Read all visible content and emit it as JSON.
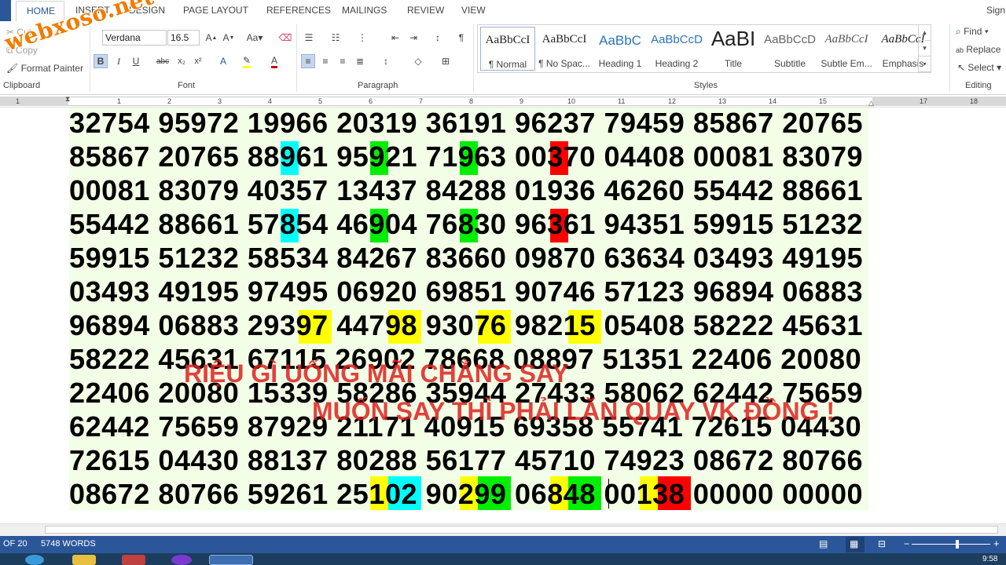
{
  "tabs": {
    "home": "HOME",
    "items": [
      "INSERT",
      "DESIGN",
      "PAGE LAYOUT",
      "REFERENCES",
      "MAILINGS",
      "REVIEW",
      "VIEW"
    ],
    "sign_in": "Sign"
  },
  "clipboard": {
    "cut": "Cut",
    "copy": "Copy",
    "format_painter": "Format Painter",
    "label": "Clipboard"
  },
  "font": {
    "name": "Verdana",
    "size": "16.5",
    "label": "Font"
  },
  "paragraph": {
    "label": "Paragraph"
  },
  "styles": {
    "label": "Styles",
    "items": [
      {
        "preview": "AaBbCcI",
        "name": "¶ Normal"
      },
      {
        "preview": "AaBbCcI",
        "name": "¶ No Spac..."
      },
      {
        "preview": "AaBbC",
        "name": "Heading 1"
      },
      {
        "preview": "AaBbCcD",
        "name": "Heading 2"
      },
      {
        "preview": "AaBI",
        "name": "Title"
      },
      {
        "preview": "AaBbCcD",
        "name": "Subtitle"
      },
      {
        "preview": "AaBbCcI",
        "name": "Subtle Em..."
      },
      {
        "preview": "AaBbCcI",
        "name": "Emphasis"
      }
    ]
  },
  "editing": {
    "find": "Find",
    "replace": "Replace",
    "select": "Select",
    "label": "Editing"
  },
  "ruler_numbers": [
    "1",
    "1",
    "2",
    "3",
    "4",
    "5",
    "6",
    "7",
    "8",
    "9",
    "10",
    "11",
    "12",
    "13",
    "14",
    "15",
    "17",
    "18"
  ],
  "document": {
    "rows": [
      "32754 95972 19966 20319 36191 96237 79459 85867 20765",
      "85867 20765 88961 95921 71963 00370 04408 00081 83079",
      "00081 83079 40357 13437 84288 01936 46260 55442 88661",
      "55442 88661 57854 46904 76830 96361 94351 59915 51232",
      "59915 51232 58534 84267 83660 09870 63634 03493 49195",
      "03493 49195 97495 06920 69851 90746 57123 96894 06883",
      "96894 06883 29397 44798 93076 98215 05408 58222 45631",
      "58222 45631 67115 26902 78668 08897 51351 22406 20080",
      "22406 20080 15339 58286 35944 27433 58062 62442 75659",
      "62442 75659 87929 21171 40915 69358 55741 72615 04430",
      "72615 04430 88137 80288 56177 45710 74923 08672 80766",
      "08672 80766 59261 25102 90299 06848 00138 00000 00000"
    ],
    "overlay_line1": "RIỆU GÌ UỐNG MÃI CHẲNG SAY",
    "overlay_line2": "MUỐN SAY THÌ PHẢI LĂN QUAY VK ĐỒNG !",
    "watermark": "webxoso.net"
  },
  "status": {
    "page": "OF 20",
    "words": "5748 WORDS"
  },
  "clock": "9:58",
  "colors": {
    "accent": "#2b579a",
    "highlight_cyan": "#00ffff",
    "highlight_green": "#00ee00",
    "highlight_red": "#ff0000",
    "highlight_yellow": "#ffff00",
    "overlay_red": "#e02020",
    "watermark_orange": "#f07c00"
  }
}
